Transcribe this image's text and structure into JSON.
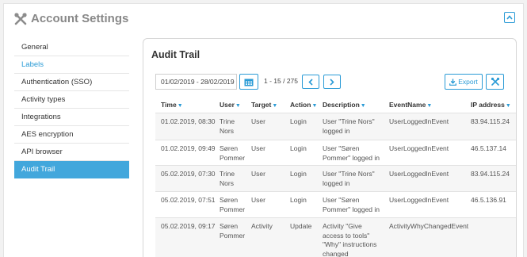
{
  "header": {
    "title": "Account Settings"
  },
  "sidebar": {
    "items": [
      {
        "label": "General"
      },
      {
        "label": "Labels"
      },
      {
        "label": "Authentication (SSO)"
      },
      {
        "label": "Activity types"
      },
      {
        "label": "Integrations"
      },
      {
        "label": "AES encryption"
      },
      {
        "label": "API browser"
      },
      {
        "label": "Audit Trail"
      }
    ]
  },
  "panel": {
    "title": "Audit Trail",
    "date_range": "01/02/2019 - 28/02/2019",
    "page_count": "1 - 15 / 275",
    "export_label": "Export"
  },
  "table": {
    "headers": [
      "Time",
      "User",
      "Target",
      "Action",
      "Description",
      "EventName",
      "IP address"
    ],
    "rows": [
      {
        "time": "01.02.2019, 08:30",
        "user": "Trine Nors",
        "target": "User",
        "action": "Login",
        "description": "User \"Trine Nors\" logged in",
        "event": "UserLoggedInEvent",
        "ip": "83.94.115.24"
      },
      {
        "time": "01.02.2019, 09:49",
        "user": "Søren Pommer",
        "target": "User",
        "action": "Login",
        "description": "User \"Søren Pommer\" logged in",
        "event": "UserLoggedInEvent",
        "ip": "46.5.137.14"
      },
      {
        "time": "05.02.2019, 07:30",
        "user": "Trine Nors",
        "target": "User",
        "action": "Login",
        "description": "User \"Trine Nors\" logged in",
        "event": "UserLoggedInEvent",
        "ip": "83.94.115.24"
      },
      {
        "time": "05.02.2019, 07:51",
        "user": "Søren Pommer",
        "target": "User",
        "action": "Login",
        "description": "User \"Søren Pommer\" logged in",
        "event": "UserLoggedInEvent",
        "ip": "46.5.136.91"
      },
      {
        "time": "05.02.2019, 09:17",
        "user": "Søren Pommer",
        "target": "Activity",
        "action": "Update",
        "description": "Activity \"Give access to tools\" \"Why\" instructions changed",
        "event": "ActivityWhyChangedEvent",
        "ip": ""
      }
    ]
  },
  "colors": {
    "accent": "#2a9bd6",
    "active_bg": "#42a7dc"
  }
}
